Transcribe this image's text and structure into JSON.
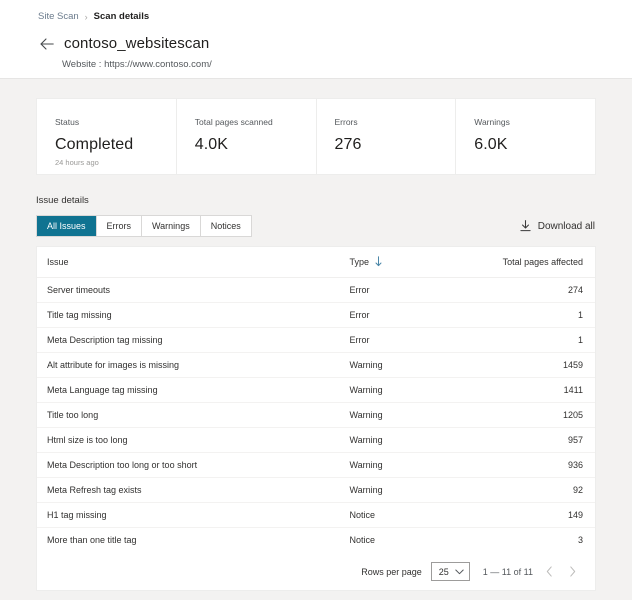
{
  "breadcrumb": {
    "root": "Site Scan",
    "separator": "›",
    "current": "Scan details"
  },
  "header": {
    "back_icon": "arrow-left-icon",
    "title": "contoso_websitescan",
    "website_line": "Website : https://www.contoso.com/"
  },
  "stats": [
    {
      "label": "Status",
      "value": "Completed",
      "sub": "24 hours ago"
    },
    {
      "label": "Total pages scanned",
      "value": "4.0K",
      "sub": ""
    },
    {
      "label": "Errors",
      "value": "276",
      "sub": ""
    },
    {
      "label": "Warnings",
      "value": "6.0K",
      "sub": ""
    }
  ],
  "issue_details": {
    "heading": "Issue details",
    "tabs": [
      {
        "label": "All Issues",
        "selected": true
      },
      {
        "label": "Errors",
        "selected": false
      },
      {
        "label": "Warnings",
        "selected": false
      },
      {
        "label": "Notices",
        "selected": false
      }
    ],
    "download_label": "Download all",
    "download_icon": "download-icon"
  },
  "table": {
    "columns": {
      "issue": "Issue",
      "type": "Type",
      "pages": "Total pages affected"
    },
    "sort_icon": "sort-descending-arrow-icon",
    "rows": [
      {
        "issue": "Server timeouts",
        "type": "Error",
        "type_kind": "error",
        "pages": "274"
      },
      {
        "issue": "Title tag missing",
        "type": "Error",
        "type_kind": "error",
        "pages": "1"
      },
      {
        "issue": "Meta Description tag missing",
        "type": "Error",
        "type_kind": "error",
        "pages": "1"
      },
      {
        "issue": "Alt attribute for images is missing",
        "type": "Warning",
        "type_kind": "warning",
        "pages": "1459"
      },
      {
        "issue": "Meta Language tag missing",
        "type": "Warning",
        "type_kind": "warning",
        "pages": "1411"
      },
      {
        "issue": "Title too long",
        "type": "Warning",
        "type_kind": "warning",
        "pages": "1205"
      },
      {
        "issue": "Html size is too long",
        "type": "Warning",
        "type_kind": "warning",
        "pages": "957"
      },
      {
        "issue": "Meta Description too long or too short",
        "type": "Warning",
        "type_kind": "warning",
        "pages": "936"
      },
      {
        "issue": "Meta Refresh tag exists",
        "type": "Warning",
        "type_kind": "warning",
        "pages": "92"
      },
      {
        "issue": "H1 tag missing",
        "type": "Notice",
        "type_kind": "notice",
        "pages": "149"
      },
      {
        "issue": "More than one title tag",
        "type": "Notice",
        "type_kind": "notice",
        "pages": "3"
      }
    ]
  },
  "pagination": {
    "rows_per_page_label": "Rows per page",
    "rows_per_page_value": "25",
    "range_label": "1 — 11 of 11",
    "prev_icon": "chevron-left-icon",
    "next_icon": "chevron-right-icon"
  },
  "colors": {
    "accent_tab": "#0f7391",
    "error": "#c4314b",
    "warning": "#c19c00",
    "notice": "#54585c",
    "page_bg": "#f3f2f1",
    "sort_arrow": "#4a87a8"
  }
}
